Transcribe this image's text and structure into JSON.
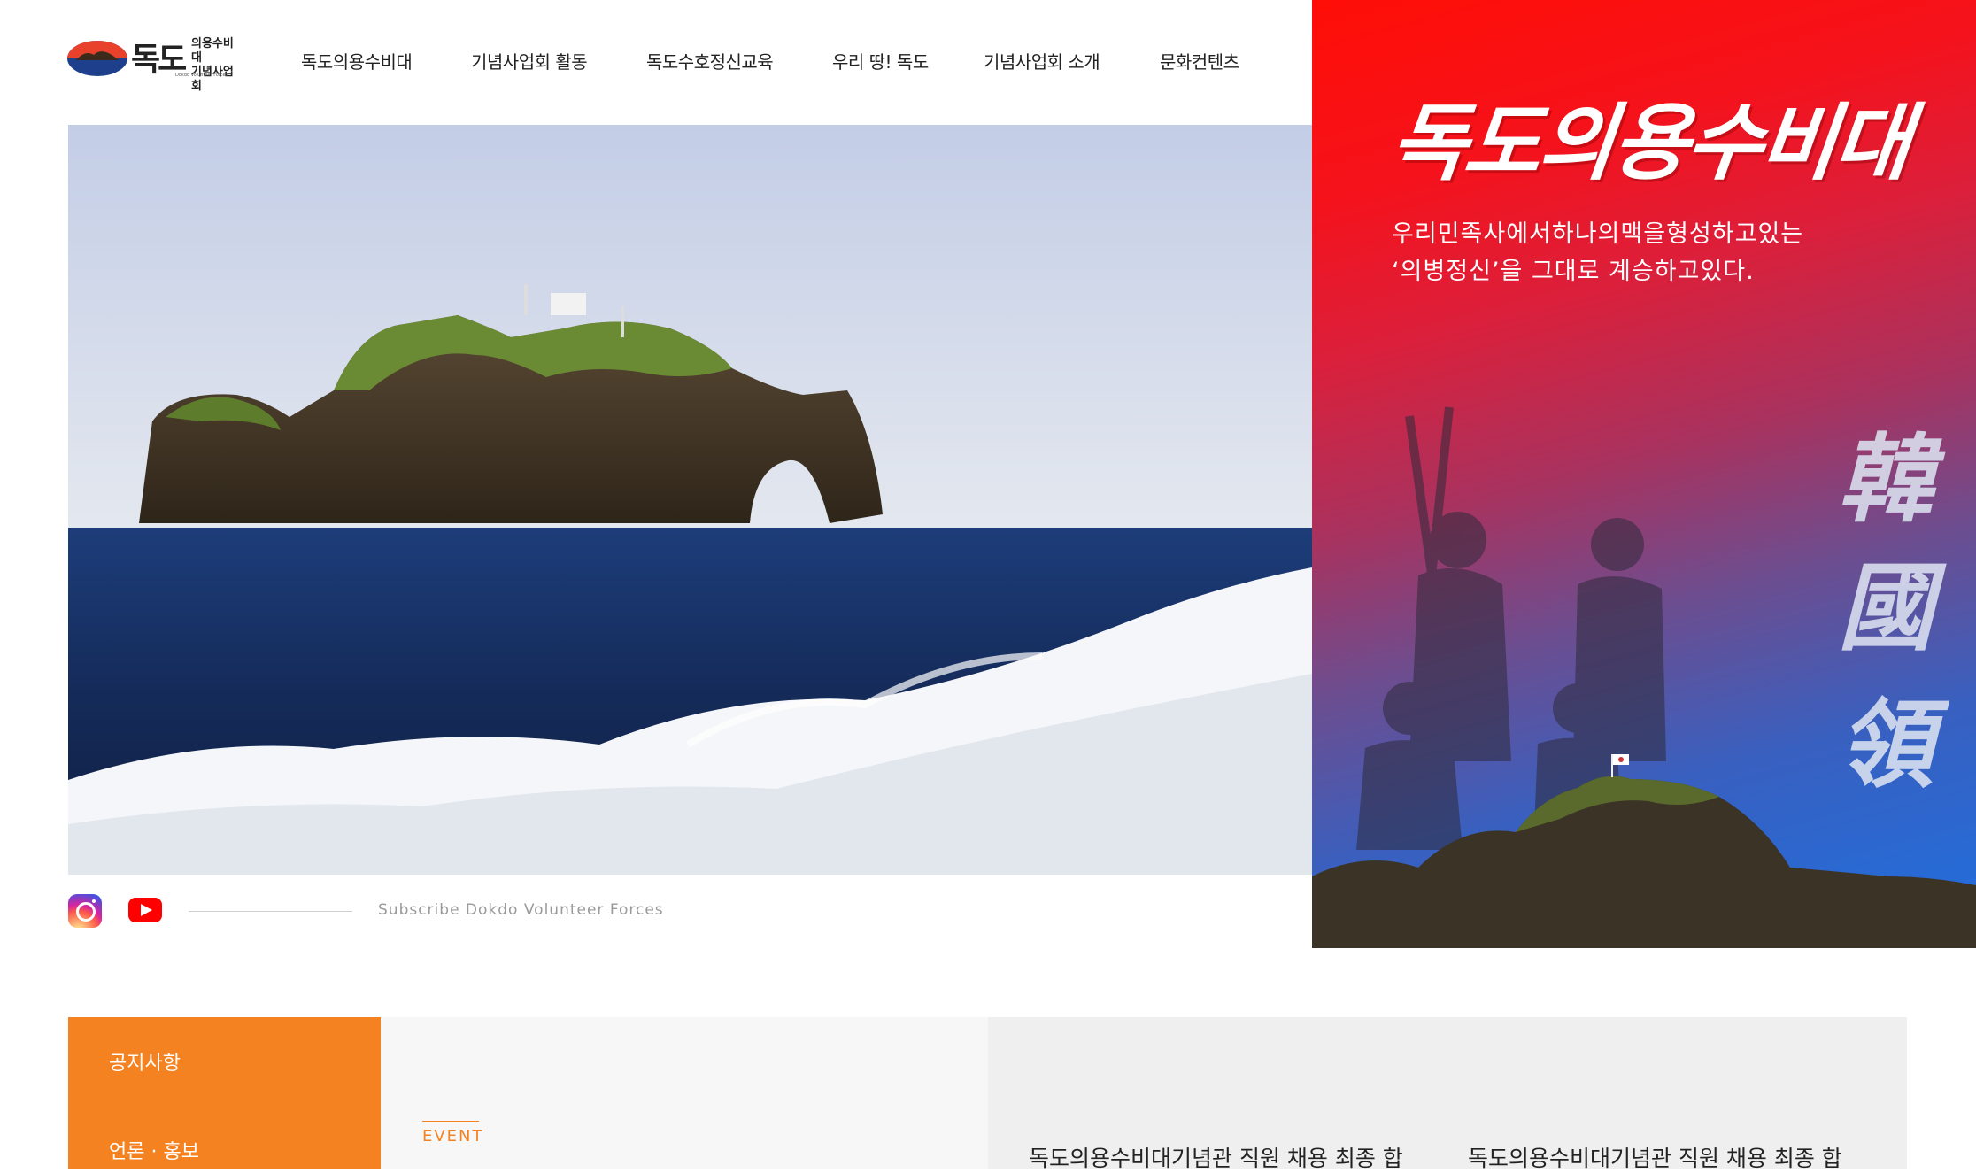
{
  "header": {
    "logo": {
      "main": "독도",
      "line1": "의용수비대",
      "line2": "기념사업회",
      "eng": "Dokdo Volunteer Forces"
    },
    "nav": [
      {
        "label": "독도의용수비대"
      },
      {
        "label": "기념사업회 활동"
      },
      {
        "label": "독도수호정신교육"
      },
      {
        "label": "우리 땅! 독도"
      },
      {
        "label": "기념사업회 소개"
      },
      {
        "label": "문화컨텐츠"
      }
    ]
  },
  "banner": {
    "title": "독도의용수비대",
    "subtitle_line1": "우리민족사에서하나의맥을형성하고있는",
    "subtitle_line2": "‘의병정신’을 그대로 계승하고있다.",
    "hanja": [
      "韓",
      "國",
      "領"
    ]
  },
  "social": {
    "instagram": "instagram-icon",
    "youtube": "youtube-icon",
    "text": "Subscribe Dokdo Volunteer Forces"
  },
  "bottom": {
    "menu": [
      {
        "label": "공지사항"
      },
      {
        "label": "언론 · 홍보"
      }
    ],
    "event_label": "EVENT",
    "news": [
      {
        "title": "독도의용수비대기념관 직원 채용 최종 합"
      },
      {
        "title": "독도의용수비대기념관 직원 채용 최종 합"
      }
    ]
  },
  "colors": {
    "accent_orange": "#f58220",
    "banner_red": "#ff0e06",
    "banner_blue": "#1f6fe0"
  }
}
